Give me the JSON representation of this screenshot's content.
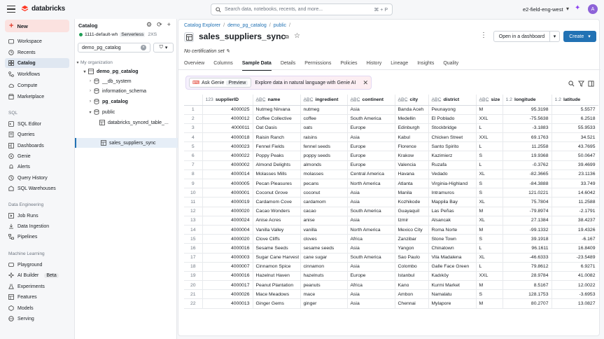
{
  "topbar": {
    "brand": "databricks",
    "search_placeholder": "Search data, notebooks, recents, and more...",
    "search_shortcut": "⌘ + P",
    "workspace": "e2-field-eng-west",
    "avatar": "A"
  },
  "nav": {
    "new_label": "New",
    "items": [
      "Workspace",
      "Recents",
      "Catalog",
      "Workflows",
      "Compute",
      "Marketplace"
    ],
    "sql_head": "SQL",
    "sql_items": [
      "SQL Editor",
      "Queries",
      "Dashboards",
      "Genie",
      "Alerts",
      "Query History",
      "SQL Warehouses"
    ],
    "de_head": "Data Engineering",
    "de_items": [
      "Job Runs",
      "Data Ingestion",
      "Pipelines"
    ],
    "ml_head": "Machine Learning",
    "ml_items": [
      "Playground",
      "AI Builder",
      "Experiments",
      "Features",
      "Models",
      "Serving"
    ],
    "beta": "Beta"
  },
  "catalog": {
    "title": "Catalog",
    "cluster": "1111-default-wh",
    "cluster_type": "Serverless",
    "cluster_size": "2XS",
    "search_value": "demo_pg_catalog",
    "my_org": "My organization",
    "tree": [
      "demo_pg_catalog",
      "__db_system",
      "information_schema",
      "pg_catalog",
      "public",
      "databricks_synced_table_...",
      "sales_suppliers_sync"
    ]
  },
  "main": {
    "breadcrumb": [
      "Catalog Explorer",
      "demo_pg_catalog",
      "public"
    ],
    "title": "sales_suppliers_sync",
    "open_dashboard": "Open in a dashboard",
    "create": "Create",
    "no_cert": "No certification set",
    "tabs": [
      "Overview",
      "Columns",
      "Sample Data",
      "Details",
      "Permissions",
      "Policies",
      "History",
      "Lineage",
      "Insights",
      "Quality"
    ],
    "active_tab": "Sample Data",
    "genie_btn": "Ask Genie",
    "genie_preview": "Preview",
    "genie_text": "Explore data in natural language with Genie AI"
  },
  "table": {
    "columns": [
      {
        "type": "123",
        "name": "supplierID"
      },
      {
        "type": "A̲B̲C̲",
        "name": "name"
      },
      {
        "type": "A̲B̲C̲",
        "name": "ingredient"
      },
      {
        "type": "A̲B̲C̲",
        "name": "continent"
      },
      {
        "type": "A̲B̲C̲",
        "name": "city"
      },
      {
        "type": "A̲B̲C̲",
        "name": "district"
      },
      {
        "type": "A̲B̲C̲",
        "name": "size"
      },
      {
        "type": "1.2",
        "name": "longitude"
      },
      {
        "type": "1.2",
        "name": "latitude"
      }
    ],
    "rows": [
      [
        "1",
        "4000025",
        "Nutmeg Nirvana",
        "nutmeg",
        "Asia",
        "Banda Aceh",
        "Peunayong",
        "M",
        "95.3198",
        "5.5577"
      ],
      [
        "2",
        "4000012",
        "Coffee Collective",
        "coffee",
        "South America",
        "Medellin",
        "El Poblado",
        "XXL",
        "-75.5638",
        "6.2518"
      ],
      [
        "3",
        "4000011",
        "Oat Oasis",
        "oats",
        "Europe",
        "Edinburgh",
        "Stockbridge",
        "L",
        "-3.1883",
        "55.9533"
      ],
      [
        "4",
        "4000018",
        "Raisin Ranch",
        "raisins",
        "Asia",
        "Kabul",
        "Chicken Street",
        "XXL",
        "69.1763",
        "34.521"
      ],
      [
        "5",
        "4000023",
        "Fennel Fields",
        "fennel seeds",
        "Europe",
        "Florence",
        "Santo Spirito",
        "L",
        "11.2558",
        "43.7695"
      ],
      [
        "6",
        "4000022",
        "Poppy Peaks",
        "poppy seeds",
        "Europe",
        "Krakow",
        "Kazimierz",
        "S",
        "19.9368",
        "50.0647"
      ],
      [
        "7",
        "4000002",
        "Almond Delights",
        "almonds",
        "Europe",
        "Valencia",
        "Ruzafa",
        "L",
        "-0.3762",
        "39.4699"
      ],
      [
        "8",
        "4000014",
        "Molasses Mills",
        "molasses",
        "Central America",
        "Havana",
        "Vedado",
        "XL",
        "-82.3665",
        "23.1136"
      ],
      [
        "9",
        "4000005",
        "Pecan Pleasures",
        "pecans",
        "North America",
        "Atlanta",
        "Virginia-Highland",
        "S",
        "-84.3888",
        "33.749"
      ],
      [
        "10",
        "4000001",
        "Coconut Grove",
        "coconut",
        "Asia",
        "Manila",
        "Intramuros",
        "S",
        "121.0221",
        "14.6042"
      ],
      [
        "11",
        "4000019",
        "Cardamom Cove",
        "cardamom",
        "Asia",
        "Kozhikode",
        "Mappila Bay",
        "XL",
        "75.7804",
        "11.2588"
      ],
      [
        "12",
        "4000020",
        "Cacao Wonders",
        "cacao",
        "South America",
        "Guayaquil",
        "Las Peñas",
        "M",
        "-79.8974",
        "-2.1791"
      ],
      [
        "13",
        "4000024",
        "Anise Acres",
        "anise",
        "Asia",
        "Izmir",
        "Alsancak",
        "XL",
        "27.1384",
        "38.4237"
      ],
      [
        "14",
        "4000004",
        "Vanilla Valley",
        "vanilla",
        "North America",
        "Mexico City",
        "Roma Norte",
        "M",
        "-99.1332",
        "19.4326"
      ],
      [
        "15",
        "4000020",
        "Clove Cliffs",
        "cloves",
        "Africa",
        "Zanzibar",
        "Stone Town",
        "S",
        "39.1918",
        "-6.167"
      ],
      [
        "16",
        "4000016",
        "Sesame Seeds",
        "sesame seeds",
        "Asia",
        "Yangon",
        "Chinatown",
        "L",
        "96.1611",
        "16.8409"
      ],
      [
        "17",
        "4000003",
        "Sugar Cane Harvest",
        "cane sugar",
        "South America",
        "Sao Paulo",
        "Vila Madalena",
        "XL",
        "-46.6333",
        "-23.5489"
      ],
      [
        "18",
        "4000007",
        "Cinnamon Spice",
        "cinnamon",
        "Asia",
        "Colombo",
        "Galle Face Green",
        "L",
        "79.8612",
        "6.9271"
      ],
      [
        "19",
        "4000016",
        "Hazelnut Haven",
        "hazelnuts",
        "Europe",
        "Istanbul",
        "Kadıköy",
        "XXL",
        "28.9784",
        "41.0082"
      ],
      [
        "20",
        "4000017",
        "Peanut Plantation",
        "peanuts",
        "Africa",
        "Kano",
        "Kurmi Market",
        "M",
        "8.5167",
        "12.0022"
      ],
      [
        "21",
        "4000026",
        "Mace Meadows",
        "mace",
        "Asia",
        "Ambon",
        "Namalatu",
        "S",
        "128.1753",
        "-3.6953"
      ],
      [
        "22",
        "4000013",
        "Ginger Gems",
        "ginger",
        "Asia",
        "Chennai",
        "Mylapore",
        "M",
        "80.2707",
        "13.0827"
      ]
    ]
  },
  "colors": {
    "accent": "#2272b4",
    "new_bg": "#fbe2e0",
    "brand_red": "#ff3621",
    "genie": "#8a3ff0"
  }
}
